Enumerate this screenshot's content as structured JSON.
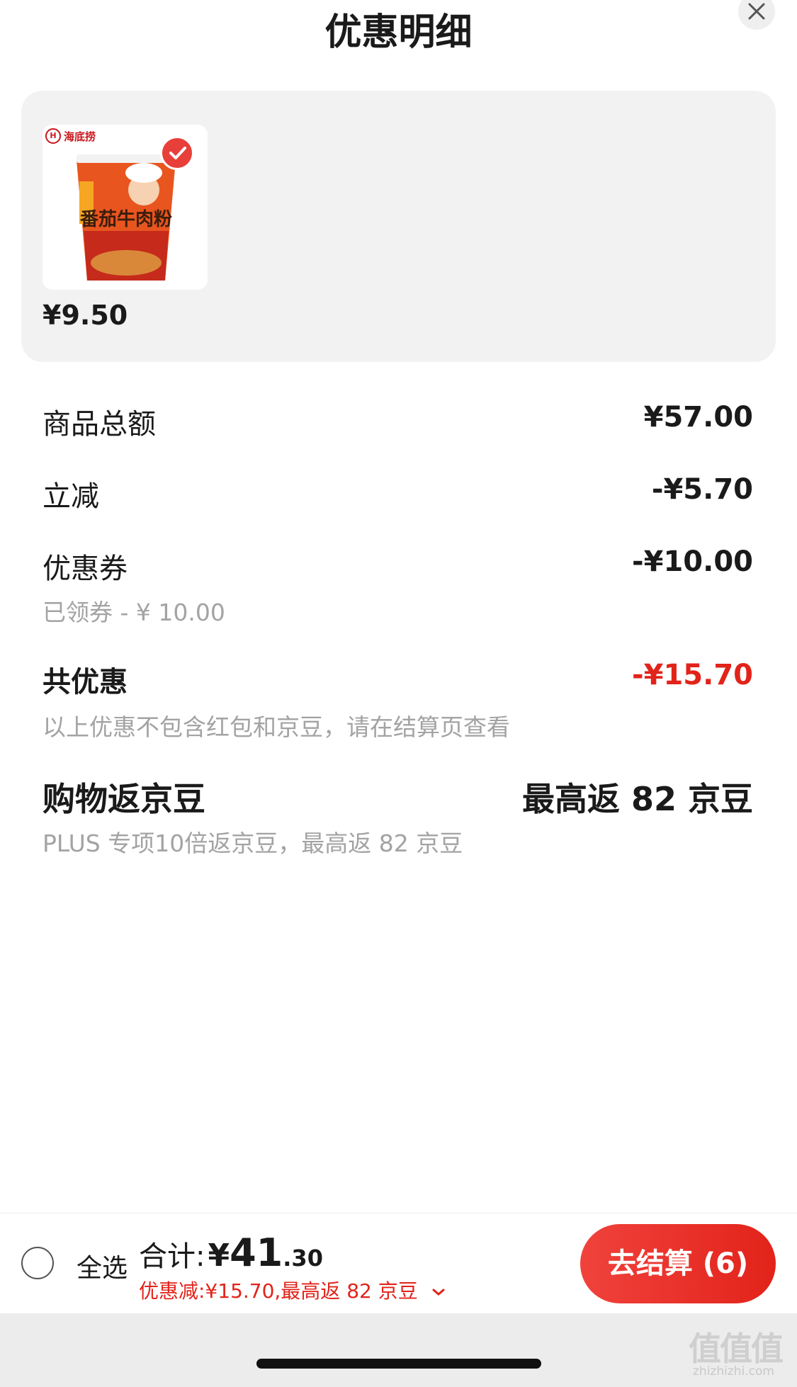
{
  "header": {
    "title": "优惠明细"
  },
  "product": {
    "brand": "海底捞",
    "package_text": "番茄牛肉粉",
    "price": "¥9.50",
    "selected": true
  },
  "breakdown": {
    "subtotal": {
      "label": "商品总额",
      "value": "¥57.00"
    },
    "instant_discount": {
      "label": "立减",
      "value": "-¥5.70"
    },
    "coupon": {
      "label": "优惠券",
      "value": "-¥10.00",
      "note": "已领券 - ¥ 10.00"
    },
    "total_discount": {
      "label": "共优惠",
      "value": "-¥15.70",
      "note": "以上优惠不包含红包和京豆，请在结算页查看"
    },
    "jd_beans": {
      "label": "购物返京豆",
      "value": "最高返 82 京豆",
      "note": "PLUS 专项10倍返京豆，最高返 82 京豆"
    }
  },
  "footer": {
    "select_all": "全选",
    "total_label": "合计:",
    "total_currency": "¥",
    "total_int": "41",
    "total_dec": ".30",
    "discount_summary": "优惠减:¥15.70,最高返 82 京豆",
    "checkout": "去结算 (6)"
  },
  "watermark": {
    "main": "值值值",
    "sub": "zhizhizhi.com"
  },
  "colors": {
    "accent": "#e2231a",
    "card_bg": "#f2f2f2",
    "muted": "#a3a3a3"
  },
  "icons": [
    "close-icon",
    "check-icon",
    "chevron-down-icon"
  ]
}
